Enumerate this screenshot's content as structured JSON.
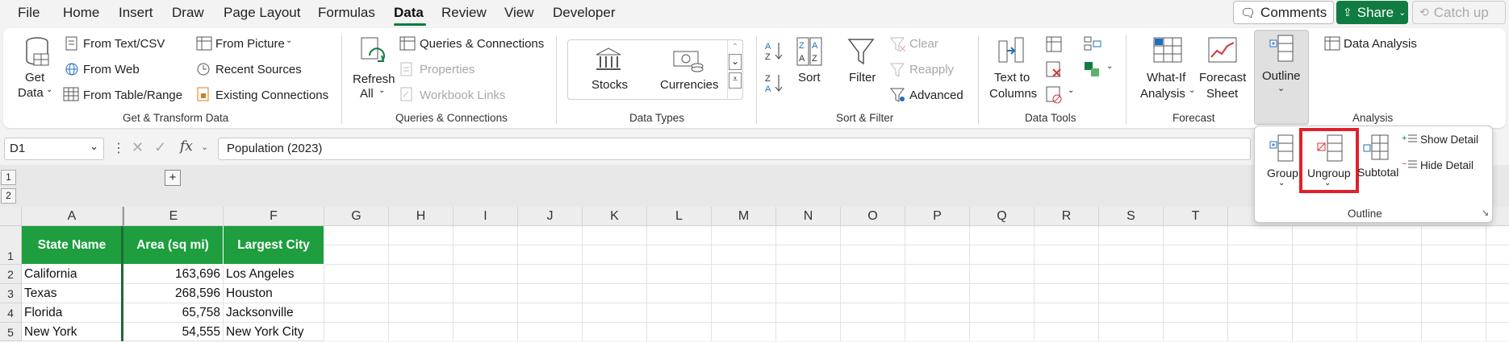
{
  "menu": {
    "file": "File",
    "home": "Home",
    "insert": "Insert",
    "draw": "Draw",
    "page_layout": "Page Layout",
    "formulas": "Formulas",
    "data": "Data",
    "review": "Review",
    "view": "View",
    "developer": "Developer"
  },
  "top_buttons": {
    "comments": "Comments",
    "share": "Share",
    "catch_up": "Catch up"
  },
  "ribbon": {
    "get_transform": {
      "get_data_l1": "Get",
      "get_data_l2": "Data",
      "from_text_csv": "From Text/CSV",
      "from_web": "From Web",
      "from_table_range": "From Table/Range",
      "from_picture": "From Picture",
      "recent_sources": "Recent Sources",
      "existing_connections": "Existing Connections",
      "label": "Get & Transform Data"
    },
    "queries": {
      "refresh_l1": "Refresh",
      "refresh_l2": "All",
      "queries_connections": "Queries & Connections",
      "properties": "Properties",
      "workbook_links": "Workbook Links",
      "label": "Queries & Connections"
    },
    "data_types": {
      "stocks": "Stocks",
      "currencies": "Currencies",
      "label": "Data Types"
    },
    "sort_filter": {
      "sort": "Sort",
      "filter": "Filter",
      "clear": "Clear",
      "reapply": "Reapply",
      "advanced": "Advanced",
      "label": "Sort & Filter"
    },
    "data_tools": {
      "text_to_l1": "Text to",
      "text_to_l2": "Columns",
      "label": "Data Tools"
    },
    "forecast": {
      "whatif_l1": "What-If",
      "whatif_l2": "Analysis",
      "forecast_l1": "Forecast",
      "forecast_l2": "Sheet",
      "label": "Forecast"
    },
    "outline_btn": "Outline",
    "analysis": {
      "data_analysis": "Data Analysis",
      "label": "Analysis"
    }
  },
  "outline_popup": {
    "group": "Group",
    "ungroup": "Ungroup",
    "subtotal": "Subtotal",
    "show_detail": "Show Detail",
    "hide_detail": "Hide Detail",
    "label": "Outline"
  },
  "formula_bar": {
    "name_box": "D1",
    "fx": "fx",
    "content": "Population (2023)"
  },
  "outline_levels": [
    "1",
    "2"
  ],
  "outline_plus": "+",
  "columns": [
    "A",
    "E",
    "F",
    "G",
    "H",
    "I",
    "J",
    "K",
    "L",
    "M",
    "N",
    "O",
    "P",
    "Q",
    "R",
    "S",
    "T"
  ],
  "rows": [
    "1",
    "2",
    "3",
    "4",
    "5"
  ],
  "table": {
    "headers": [
      "State Name",
      "Area (sq mi)",
      "Largest City"
    ],
    "rows": [
      [
        "California",
        "163,696",
        "Los Angeles"
      ],
      [
        "Texas",
        "268,596",
        "Houston"
      ],
      [
        "Florida",
        "65,758",
        "Jacksonville"
      ],
      [
        "New York",
        "54,555",
        "New York City"
      ]
    ]
  },
  "colors": {
    "accent": "#107c41",
    "header_fill": "#1e9e3e",
    "highlight": "#e0202a"
  }
}
